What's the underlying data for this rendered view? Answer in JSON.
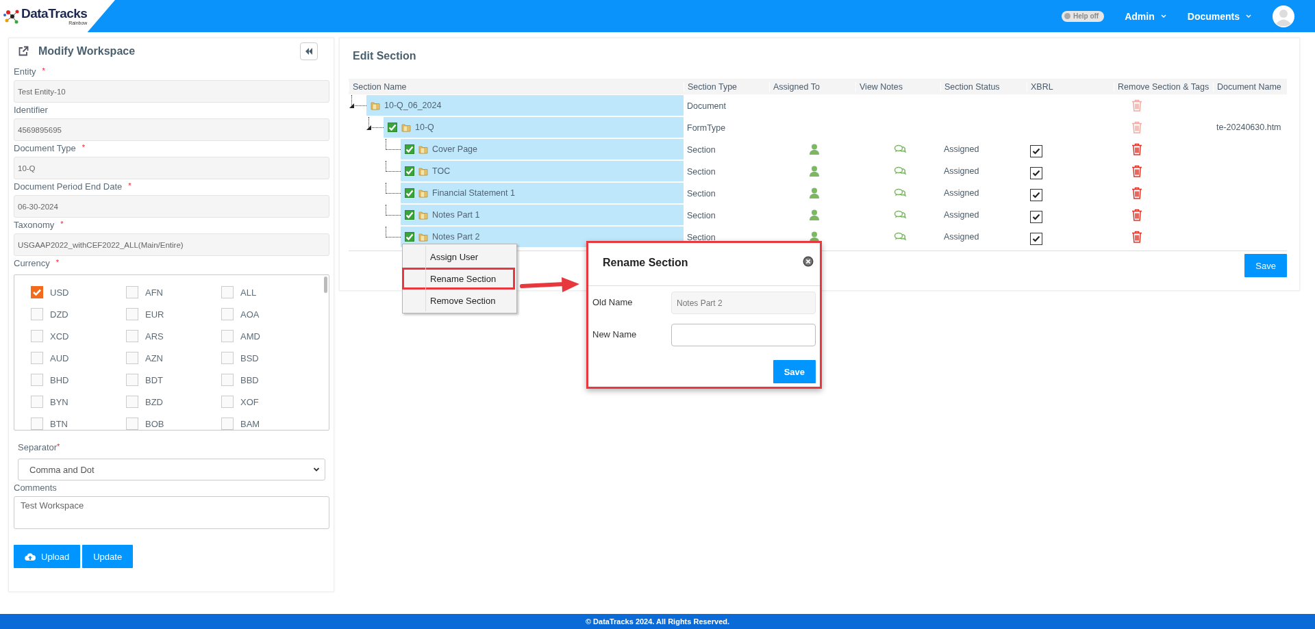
{
  "header": {
    "logo": {
      "name": "DataTracks",
      "tagline": "Rainbow"
    },
    "help_toggle": {
      "label": "Help off",
      "on": false
    },
    "menus": [
      {
        "label": "Admin"
      },
      {
        "label": "Documents"
      }
    ]
  },
  "workspace": {
    "title": "Modify Workspace",
    "fields": [
      {
        "label": "Entity",
        "required_mark": "*",
        "value": "Test Entity-10"
      },
      {
        "label": "Identifier",
        "value": "4569895695"
      },
      {
        "label": "Document Type",
        "required_mark": "*",
        "value": "10-Q"
      },
      {
        "label": "Document Period End Date",
        "required_mark": "*",
        "value": "06-30-2024"
      },
      {
        "label": "Taxonomy",
        "required_mark": "*",
        "value": "USGAAP2022_withCEF2022_ALL(Main/Entire)"
      }
    ],
    "currency": {
      "label": "Currency",
      "required_mark": "*",
      "options": [
        {
          "code": "USD",
          "checked": true
        },
        {
          "code": "AFN",
          "checked": false
        },
        {
          "code": "ALL",
          "checked": false
        },
        {
          "code": "DZD",
          "checked": false
        },
        {
          "code": "EUR",
          "checked": false
        },
        {
          "code": "AOA",
          "checked": false
        },
        {
          "code": "XCD",
          "checked": false
        },
        {
          "code": "ARS",
          "checked": false
        },
        {
          "code": "AMD",
          "checked": false
        },
        {
          "code": "AUD",
          "checked": false
        },
        {
          "code": "AZN",
          "checked": false
        },
        {
          "code": "BSD",
          "checked": false
        },
        {
          "code": "BHD",
          "checked": false
        },
        {
          "code": "BDT",
          "checked": false
        },
        {
          "code": "BBD",
          "checked": false
        },
        {
          "code": "BYN",
          "checked": false
        },
        {
          "code": "BZD",
          "checked": false
        },
        {
          "code": "XOF",
          "checked": false
        },
        {
          "code": "BTN",
          "checked": false
        },
        {
          "code": "BOB",
          "checked": false
        },
        {
          "code": "BAM",
          "checked": false
        }
      ]
    },
    "separator": {
      "label": "Separator",
      "required_mark": "*",
      "value": "Comma and Dot"
    },
    "comments": {
      "label": "Comments",
      "value": "Test Workspace"
    },
    "buttons": [
      {
        "label": "Upload",
        "kind": "upload"
      },
      {
        "label": "Update",
        "kind": "plain"
      }
    ]
  },
  "edit_section": {
    "title": "Edit Section",
    "columns": [
      "Section Name",
      "Section Type",
      "Assigned To",
      "View Notes",
      "Section Status",
      "XBRL",
      "Remove Section & Tags",
      "Document Name"
    ],
    "tree": [
      {
        "name": "10-Q_06_2024",
        "expanded": true,
        "section_type": "Document",
        "remove_disabled": true,
        "children": [
          {
            "name": "10-Q",
            "expanded": true,
            "checked": true,
            "section_type": "FormType",
            "remove_disabled": true,
            "document_name": "te-20240630.htm",
            "children": [
              {
                "name": "Cover Page",
                "kind": "section",
                "checked": true,
                "section_type": "Section",
                "status": "Assigned",
                "xbrl": true,
                "remove_disabled": false
              },
              {
                "name": "TOC",
                "kind": "section",
                "checked": true,
                "section_type": "Section",
                "status": "Assigned",
                "xbrl": true,
                "remove_disabled": false
              },
              {
                "name": "Financial Statement 1",
                "kind": "section",
                "checked": true,
                "section_type": "Section",
                "status": "Assigned",
                "xbrl": true,
                "remove_disabled": false
              },
              {
                "name": "Notes Part 1",
                "kind": "section",
                "checked": true,
                "section_type": "Section",
                "status": "Assigned",
                "xbrl": true,
                "remove_disabled": false
              },
              {
                "name": "Notes Part 2",
                "kind": "section",
                "checked": true,
                "section_type": "Section",
                "status": "Assigned",
                "xbrl": true,
                "remove_disabled": false
              }
            ]
          }
        ]
      }
    ],
    "save_label": "Save"
  },
  "context_menu": [
    {
      "label": "Assign User",
      "selected": false
    },
    {
      "label": "Rename Section",
      "selected": true
    },
    {
      "label": "Remove Section",
      "selected": false
    }
  ],
  "dialog": {
    "title": "Rename Section",
    "fields": [
      {
        "label": "Old Name",
        "value": "Notes Part 2",
        "disabled": true
      },
      {
        "label": "New Name",
        "disabled": false
      }
    ],
    "save_label": "Save"
  },
  "footer": "© DataTracks 2024. All Rights Reserved."
}
